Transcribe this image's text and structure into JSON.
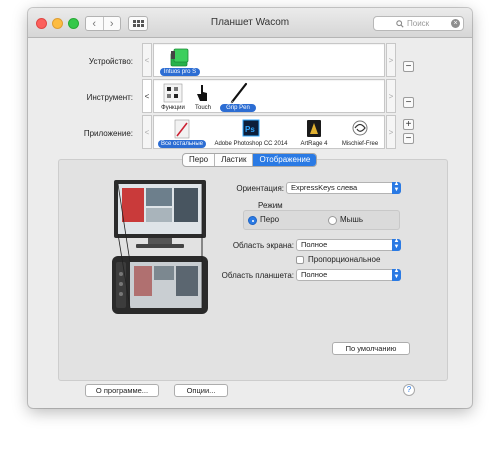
{
  "window": {
    "title": "Планшет Wacom",
    "nav_back": "‹",
    "nav_forward": "›",
    "search_placeholder": "Поиск",
    "search_clear": "×"
  },
  "rows": {
    "device": {
      "label": "Устройство:",
      "items": [
        {
          "label": "Intuos pro S",
          "selected": true,
          "icon": "tablet-icon"
        }
      ]
    },
    "tool": {
      "label": "Инструмент:",
      "items": [
        {
          "label": "Функции",
          "selected": false,
          "icon": "functions-icon"
        },
        {
          "label": "Touch",
          "selected": false,
          "icon": "touch-icon"
        },
        {
          "label": "Grip Pen",
          "selected": true,
          "icon": "pen-icon"
        }
      ]
    },
    "app": {
      "label": "Приложение:",
      "items": [
        {
          "label": "Все остальные",
          "selected": true,
          "icon": "all-apps-icon"
        },
        {
          "label": "Adobe Photoshop CC 2014",
          "selected": false,
          "icon": "photoshop-icon"
        },
        {
          "label": "ArtRage 4",
          "selected": false,
          "icon": "artrage-icon"
        },
        {
          "label": "Mischief-Free",
          "selected": false,
          "icon": "mischief-icon"
        }
      ]
    },
    "left_arrow": "<",
    "right_arrow": ">",
    "add": "+",
    "remove": "−"
  },
  "tabs": [
    {
      "label": "Перо",
      "active": false
    },
    {
      "label": "Ластик",
      "active": false
    },
    {
      "label": "Отображение",
      "active": true
    }
  ],
  "mapping": {
    "orientation_label": "Ориентация:",
    "orientation_value": "ExpressKeys слева",
    "mode_label": "Режим",
    "mode_pen": "Перо",
    "mode_mouse": "Мышь",
    "mode_selected": "pen",
    "screen_area_label": "Область экрана:",
    "screen_area_value": "Полное",
    "proportional_label": "Пропорциональное",
    "proportional_checked": false,
    "tablet_area_label": "Область планшета:",
    "tablet_area_value": "Полное",
    "default_button": "По умолчанию"
  },
  "footer": {
    "about_button": "О программе...",
    "options_button": "Опции...",
    "help": "?"
  },
  "colors": {
    "accent": "#2a7ae4",
    "selection": "#2c6dd3"
  }
}
